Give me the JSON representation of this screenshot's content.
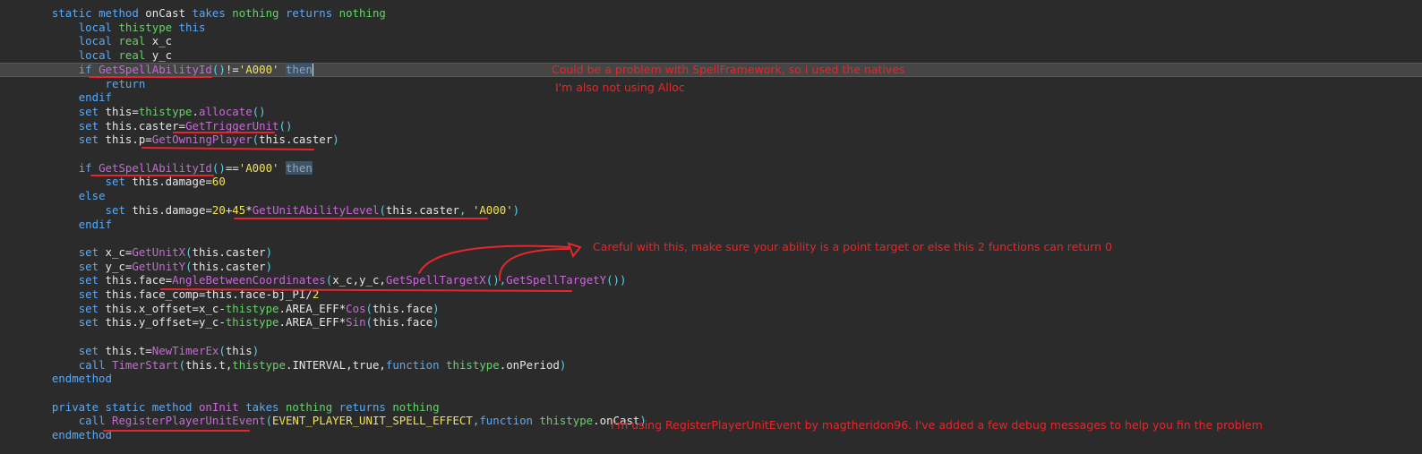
{
  "editor": {
    "lines": [
      {
        "indent": "    ",
        "tokens": [
          [
            "kw",
            "static "
          ],
          [
            "kw",
            "method "
          ],
          [
            "id",
            "onCast "
          ],
          [
            "kw",
            "takes "
          ],
          [
            "type",
            "nothing "
          ],
          [
            "kw",
            "returns "
          ],
          [
            "type",
            "nothing"
          ]
        ]
      },
      {
        "indent": "        ",
        "tokens": [
          [
            "kw",
            "local "
          ],
          [
            "type",
            "thistype "
          ],
          [
            "kw",
            "this"
          ]
        ]
      },
      {
        "indent": "        ",
        "tokens": [
          [
            "kw",
            "local "
          ],
          [
            "type",
            "real "
          ],
          [
            "id",
            "x_c"
          ]
        ]
      },
      {
        "indent": "        ",
        "tokens": [
          [
            "kw",
            "local "
          ],
          [
            "type",
            "real "
          ],
          [
            "id",
            "y_c"
          ]
        ]
      },
      {
        "indent": "        ",
        "highlight": true,
        "cursor": true,
        "tokens": [
          [
            "kw",
            "if "
          ],
          [
            "fn",
            "GetSpellAbilityId"
          ],
          [
            "punct",
            "()"
          ],
          [
            "op",
            "!="
          ],
          [
            "str",
            "'A000' "
          ],
          [
            "then",
            "then"
          ]
        ]
      },
      {
        "indent": "            ",
        "tokens": [
          [
            "kw",
            "return"
          ]
        ]
      },
      {
        "indent": "        ",
        "tokens": [
          [
            "kw",
            "endif"
          ]
        ]
      },
      {
        "indent": "        ",
        "tokens": [
          [
            "kw",
            "set "
          ],
          [
            "id",
            "this"
          ],
          [
            "op",
            "="
          ],
          [
            "type",
            "thistype"
          ],
          [
            "op",
            "."
          ],
          [
            "fn",
            "allocate"
          ],
          [
            "punct",
            "()"
          ]
        ]
      },
      {
        "indent": "        ",
        "tokens": [
          [
            "kw",
            "set "
          ],
          [
            "id",
            "this.caster"
          ],
          [
            "op",
            "="
          ],
          [
            "fn",
            "GetTriggerUnit"
          ],
          [
            "punct",
            "()"
          ]
        ]
      },
      {
        "indent": "        ",
        "tokens": [
          [
            "kw",
            "set "
          ],
          [
            "id",
            "this.p"
          ],
          [
            "op",
            "="
          ],
          [
            "fn",
            "GetOwningPlayer"
          ],
          [
            "punct",
            "("
          ],
          [
            "id",
            "this.caster"
          ],
          [
            "punct",
            ")"
          ]
        ]
      },
      {
        "indent": "",
        "tokens": []
      },
      {
        "indent": "        ",
        "tokens": [
          [
            "kw",
            "if "
          ],
          [
            "fn",
            "GetSpellAbilityId"
          ],
          [
            "punct",
            "()"
          ],
          [
            "op",
            "=="
          ],
          [
            "str",
            "'A000' "
          ],
          [
            "then",
            "then"
          ]
        ]
      },
      {
        "indent": "            ",
        "tokens": [
          [
            "kw",
            "set "
          ],
          [
            "id",
            "this.damage"
          ],
          [
            "op",
            "="
          ],
          [
            "num",
            "60"
          ]
        ]
      },
      {
        "indent": "        ",
        "tokens": [
          [
            "kw",
            "else"
          ]
        ]
      },
      {
        "indent": "            ",
        "tokens": [
          [
            "kw",
            "set "
          ],
          [
            "id",
            "this.damage"
          ],
          [
            "op",
            "="
          ],
          [
            "num",
            "20"
          ],
          [
            "op",
            "+"
          ],
          [
            "num",
            "45"
          ],
          [
            "op",
            "*"
          ],
          [
            "fn",
            "GetUnitAbilityLevel"
          ],
          [
            "punct",
            "("
          ],
          [
            "id",
            "this.caster"
          ],
          [
            "punct",
            ", "
          ],
          [
            "str",
            "'A000'"
          ],
          [
            "punct",
            ")"
          ]
        ]
      },
      {
        "indent": "        ",
        "tokens": [
          [
            "kw",
            "endif"
          ]
        ]
      },
      {
        "indent": "",
        "tokens": []
      },
      {
        "indent": "        ",
        "tokens": [
          [
            "kw",
            "set "
          ],
          [
            "id",
            "x_c"
          ],
          [
            "op",
            "="
          ],
          [
            "fn",
            "GetUnitX"
          ],
          [
            "punct",
            "("
          ],
          [
            "id",
            "this.caster"
          ],
          [
            "punct",
            ")"
          ]
        ]
      },
      {
        "indent": "        ",
        "tokens": [
          [
            "kw",
            "set "
          ],
          [
            "id",
            "y_c"
          ],
          [
            "op",
            "="
          ],
          [
            "fn",
            "GetUnitY"
          ],
          [
            "punct",
            "("
          ],
          [
            "id",
            "this.caster"
          ],
          [
            "punct",
            ")"
          ]
        ]
      },
      {
        "indent": "        ",
        "tokens": [
          [
            "kw",
            "set "
          ],
          [
            "id",
            "this.face"
          ],
          [
            "op",
            "="
          ],
          [
            "fn",
            "AngleBetweenCoordinates"
          ],
          [
            "punct",
            "("
          ],
          [
            "id",
            "x_c,y_c,"
          ],
          [
            "fn",
            "GetSpellTargetX"
          ],
          [
            "punct",
            "(),"
          ],
          [
            "fn",
            "GetSpellTargetY"
          ],
          [
            "punct",
            "())"
          ]
        ]
      },
      {
        "indent": "        ",
        "tokens": [
          [
            "kw",
            "set "
          ],
          [
            "id",
            "this.face_comp"
          ],
          [
            "op",
            "="
          ],
          [
            "id",
            "this.face"
          ],
          [
            "op",
            "-"
          ],
          [
            "id",
            "bj_PI"
          ],
          [
            "op",
            "/"
          ],
          [
            "num",
            "2"
          ]
        ]
      },
      {
        "indent": "        ",
        "tokens": [
          [
            "kw",
            "set "
          ],
          [
            "id",
            "this.x_offset"
          ],
          [
            "op",
            "="
          ],
          [
            "id",
            "x_c"
          ],
          [
            "op",
            "-"
          ],
          [
            "type",
            "thistype"
          ],
          [
            "op",
            "."
          ],
          [
            "id",
            "AREA_EFF"
          ],
          [
            "op",
            "*"
          ],
          [
            "fn",
            "Cos"
          ],
          [
            "punct",
            "("
          ],
          [
            "id",
            "this.face"
          ],
          [
            "punct",
            ")"
          ]
        ]
      },
      {
        "indent": "        ",
        "tokens": [
          [
            "kw",
            "set "
          ],
          [
            "id",
            "this.y_offset"
          ],
          [
            "op",
            "="
          ],
          [
            "id",
            "y_c"
          ],
          [
            "op",
            "-"
          ],
          [
            "type",
            "thistype"
          ],
          [
            "op",
            "."
          ],
          [
            "id",
            "AREA_EFF"
          ],
          [
            "op",
            "*"
          ],
          [
            "fn",
            "Sin"
          ],
          [
            "punct",
            "("
          ],
          [
            "id",
            "this.face"
          ],
          [
            "punct",
            ")"
          ]
        ]
      },
      {
        "indent": "",
        "tokens": []
      },
      {
        "indent": "        ",
        "tokens": [
          [
            "kw",
            "set "
          ],
          [
            "id",
            "this.t"
          ],
          [
            "op",
            "="
          ],
          [
            "fn",
            "NewTimerEx"
          ],
          [
            "punct",
            "("
          ],
          [
            "id",
            "this"
          ],
          [
            "punct",
            ")"
          ]
        ]
      },
      {
        "indent": "        ",
        "tokens": [
          [
            "kw",
            "call "
          ],
          [
            "fn",
            "TimerStart"
          ],
          [
            "punct",
            "("
          ],
          [
            "id",
            "this.t,"
          ],
          [
            "type",
            "thistype"
          ],
          [
            "op",
            "."
          ],
          [
            "id",
            "INTERVAL,true,"
          ],
          [
            "kw",
            "function "
          ],
          [
            "type",
            "thistype"
          ],
          [
            "op",
            "."
          ],
          [
            "id",
            "onPeriod"
          ],
          [
            "punct",
            ")"
          ]
        ]
      },
      {
        "indent": "    ",
        "tokens": [
          [
            "kw",
            "endmethod"
          ]
        ]
      },
      {
        "indent": "",
        "tokens": []
      },
      {
        "indent": "    ",
        "tokens": [
          [
            "kw",
            "private "
          ],
          [
            "kw",
            "static "
          ],
          [
            "kw",
            "method "
          ],
          [
            "fn",
            "onInit "
          ],
          [
            "kw",
            "takes "
          ],
          [
            "type",
            "nothing "
          ],
          [
            "kw",
            "returns "
          ],
          [
            "type",
            "nothing"
          ]
        ]
      },
      {
        "indent": "        ",
        "tokens": [
          [
            "kw",
            "call "
          ],
          [
            "fn",
            "RegisterPlayerUnitEvent"
          ],
          [
            "punct",
            "("
          ],
          [
            "str",
            "EVENT_PLAYER_UNIT_SPELL_EFFECT"
          ],
          [
            "punct",
            ","
          ],
          [
            "kw",
            "function "
          ],
          [
            "type",
            "thistype"
          ],
          [
            "op",
            "."
          ],
          [
            "id",
            "onCast"
          ],
          [
            "punct",
            ")"
          ]
        ]
      },
      {
        "indent": "    ",
        "tokens": [
          [
            "kw",
            "endmethod"
          ]
        ]
      }
    ]
  },
  "annotations": {
    "note1_line1": "Could be a problem with SpellFramework, so i used the natives",
    "note1_line2": "I'm also not using Alloc",
    "note2": "Careful with this, make sure your ability is a point target or else this 2 functions can return 0",
    "note3": "I'm using RegisterPlayerUnitEvent by magtheridon96. I've added a few debug messages to help you fin the problem"
  },
  "colors": {
    "background": "#2b2b2b",
    "annotation": "#e8262a",
    "keyword": "#5aa9f5",
    "type": "#67d16b",
    "function": "#c869d8",
    "string": "#f1e35b"
  }
}
